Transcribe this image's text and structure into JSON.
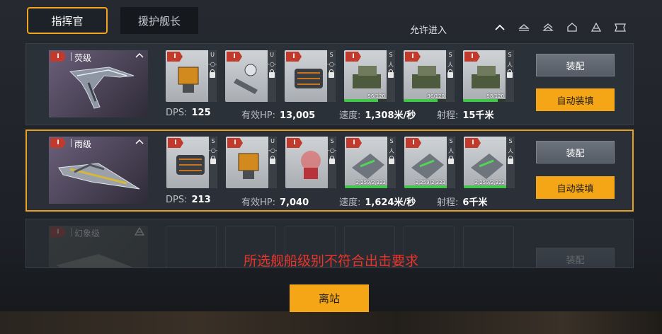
{
  "tabs": [
    {
      "label": "指挥官",
      "active": true
    },
    {
      "label": "援护舰长",
      "active": false
    }
  ],
  "filter": {
    "label": "允许进入",
    "icons": [
      "chevron-up-icon",
      "frigate-class-icon",
      "destroyer-class-icon",
      "cruiser-class-icon",
      "battlecruiser-class-icon",
      "battleship-class-icon"
    ]
  },
  "ships": [
    {
      "tier": "I",
      "class": "荧级",
      "slots": [
        {
          "tier": "I",
          "type": "U",
          "glyph": "-○-",
          "fill": null,
          "hp": ""
        },
        {
          "tier": "I",
          "type": "U",
          "glyph": "-○-",
          "fill": null,
          "hp": ""
        },
        {
          "tier": "I",
          "type": "S",
          "glyph": "-○-",
          "fill": null,
          "hp": ""
        },
        {
          "tier": "I",
          "type": "S",
          "glyph": "人",
          "fill": 0.8,
          "hp": "96/120"
        },
        {
          "tier": "I",
          "type": "S",
          "glyph": "人",
          "fill": 0.8,
          "hp": "96/120"
        },
        {
          "tier": "I",
          "type": "S",
          "glyph": "人",
          "fill": 0.82,
          "hp": "98/120"
        }
      ],
      "stats": {
        "dps_label": "DPS:",
        "dps": "125",
        "hp_label": "有效HP:",
        "hp": "13,005",
        "speed_label": "速度:",
        "speed": "1,308米/秒",
        "range_label": "射程:",
        "range": "15千米"
      },
      "equip_label": "装配",
      "auto_label": "自动装填"
    },
    {
      "tier": "I",
      "class": "雨级",
      "slots": [
        {
          "tier": "I",
          "type": "S",
          "glyph": "-○-",
          "fill": null,
          "hp": ""
        },
        {
          "tier": "I",
          "type": "U",
          "glyph": "-○-",
          "fill": null,
          "hp": ""
        },
        {
          "tier": "I",
          "type": "S",
          "glyph": "-○-",
          "fill": null,
          "hp": ""
        },
        {
          "tier": "I",
          "type": "S",
          "glyph": "人",
          "fill": 1.0,
          "hp": "2,259/2,323"
        },
        {
          "tier": "I",
          "type": "S",
          "glyph": "人",
          "fill": 1.0,
          "hp": "2,259/2,323"
        },
        {
          "tier": "I",
          "type": "S",
          "glyph": "人",
          "fill": 1.0,
          "hp": "2,259/2,323"
        }
      ],
      "stats": {
        "dps_label": "DPS:",
        "dps": "213",
        "hp_label": "有效HP:",
        "hp": "7,040",
        "speed_label": "速度:",
        "speed": "1,624米/秒",
        "range_label": "射程:",
        "range": "6千米"
      },
      "equip_label": "装配",
      "auto_label": "自动装填"
    },
    {
      "tier": "I",
      "class": "幻象级",
      "equip_label": "装配"
    }
  ],
  "warning": "所选舰船级别不符合出击要求",
  "leave_label": "离站",
  "colors": {
    "accent": "#f5a616",
    "warning": "#e8342a",
    "tier": "#c23a2c"
  }
}
